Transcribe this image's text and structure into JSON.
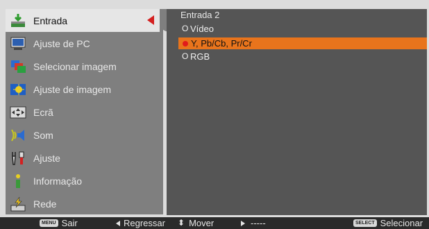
{
  "sidebar": {
    "items": [
      {
        "label": "Entrada",
        "icon": "input-icon"
      },
      {
        "label": "Ajuste de PC",
        "icon": "pc-adjust-icon"
      },
      {
        "label": "Selecionar imagem",
        "icon": "image-select-icon"
      },
      {
        "label": "Ajuste de imagem",
        "icon": "image-adjust-icon"
      },
      {
        "label": "Ecrã",
        "icon": "screen-icon"
      },
      {
        "label": "Som",
        "icon": "sound-icon"
      },
      {
        "label": "Ajuste",
        "icon": "setting-icon"
      },
      {
        "label": "Informação",
        "icon": "info-icon"
      },
      {
        "label": "Rede",
        "icon": "network-icon"
      }
    ]
  },
  "panel": {
    "title": "Entrada 2",
    "options": [
      {
        "label": "Vídeo",
        "selected": false
      },
      {
        "label": "Y, Pb/Cb, Pr/Cr",
        "selected": true
      },
      {
        "label": "RGB",
        "selected": false
      }
    ]
  },
  "footer": {
    "menu_key": "MENU",
    "exit": "Sair",
    "back": "Regressar",
    "move": "Mover",
    "dashes": "-----",
    "select_key": "SELECT",
    "select": "Selecionar"
  },
  "colors": {
    "highlight": "#e8741c",
    "accent_red": "#d42020",
    "sidebar_bg": "#7f7f7f",
    "panel_bg": "#555555"
  }
}
